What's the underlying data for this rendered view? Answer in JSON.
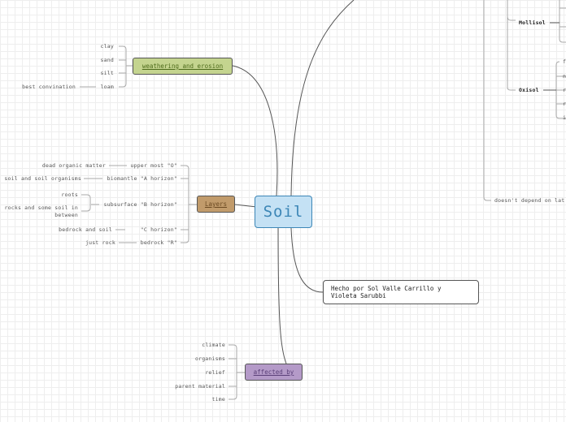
{
  "central_topic": "Soil",
  "weathering": {
    "title": "weathering and erosion",
    "items": [
      "clay",
      "sand",
      "silt",
      "loam"
    ],
    "loam_note": "best convination"
  },
  "layers": {
    "title": "Layers",
    "horizons": [
      {
        "name": "upper most \"O\"",
        "detail": "dead organic matter"
      },
      {
        "name": "biomantle \"A horizon\"",
        "detail": "soil and soil organisms"
      },
      {
        "name": "subsurface \"B horizon\"",
        "details": [
          "roots",
          "rocks and some soil in between"
        ]
      },
      {
        "name": "\"C horizon\"",
        "detail": "bedrock and soil"
      },
      {
        "name": "bedrock \"R\"",
        "detail": "just rock"
      }
    ]
  },
  "affected_by": {
    "title": "affected by",
    "items": [
      "climate",
      "organisms",
      "relief",
      "parent material",
      "time"
    ]
  },
  "credit": "Hecho por Sol Valle Carrillo y\nVioleta Sarubbi",
  "soil_types": {
    "mollisol": "Mollisol",
    "oxisol": "Oxisol",
    "oxisol_items": [
      "f",
      "n",
      "r",
      "r",
      "i"
    ],
    "latitude_note": "doesn't depend on lat"
  },
  "colors": {
    "central_fill": "#c4e1f4",
    "central_border": "#3c86b6",
    "weathering_fill": "#c4d48f",
    "layers_fill": "#c19b6b",
    "affected_fill": "#b49ac8",
    "connector": "#555555",
    "bracket": "#aaaaaa"
  }
}
